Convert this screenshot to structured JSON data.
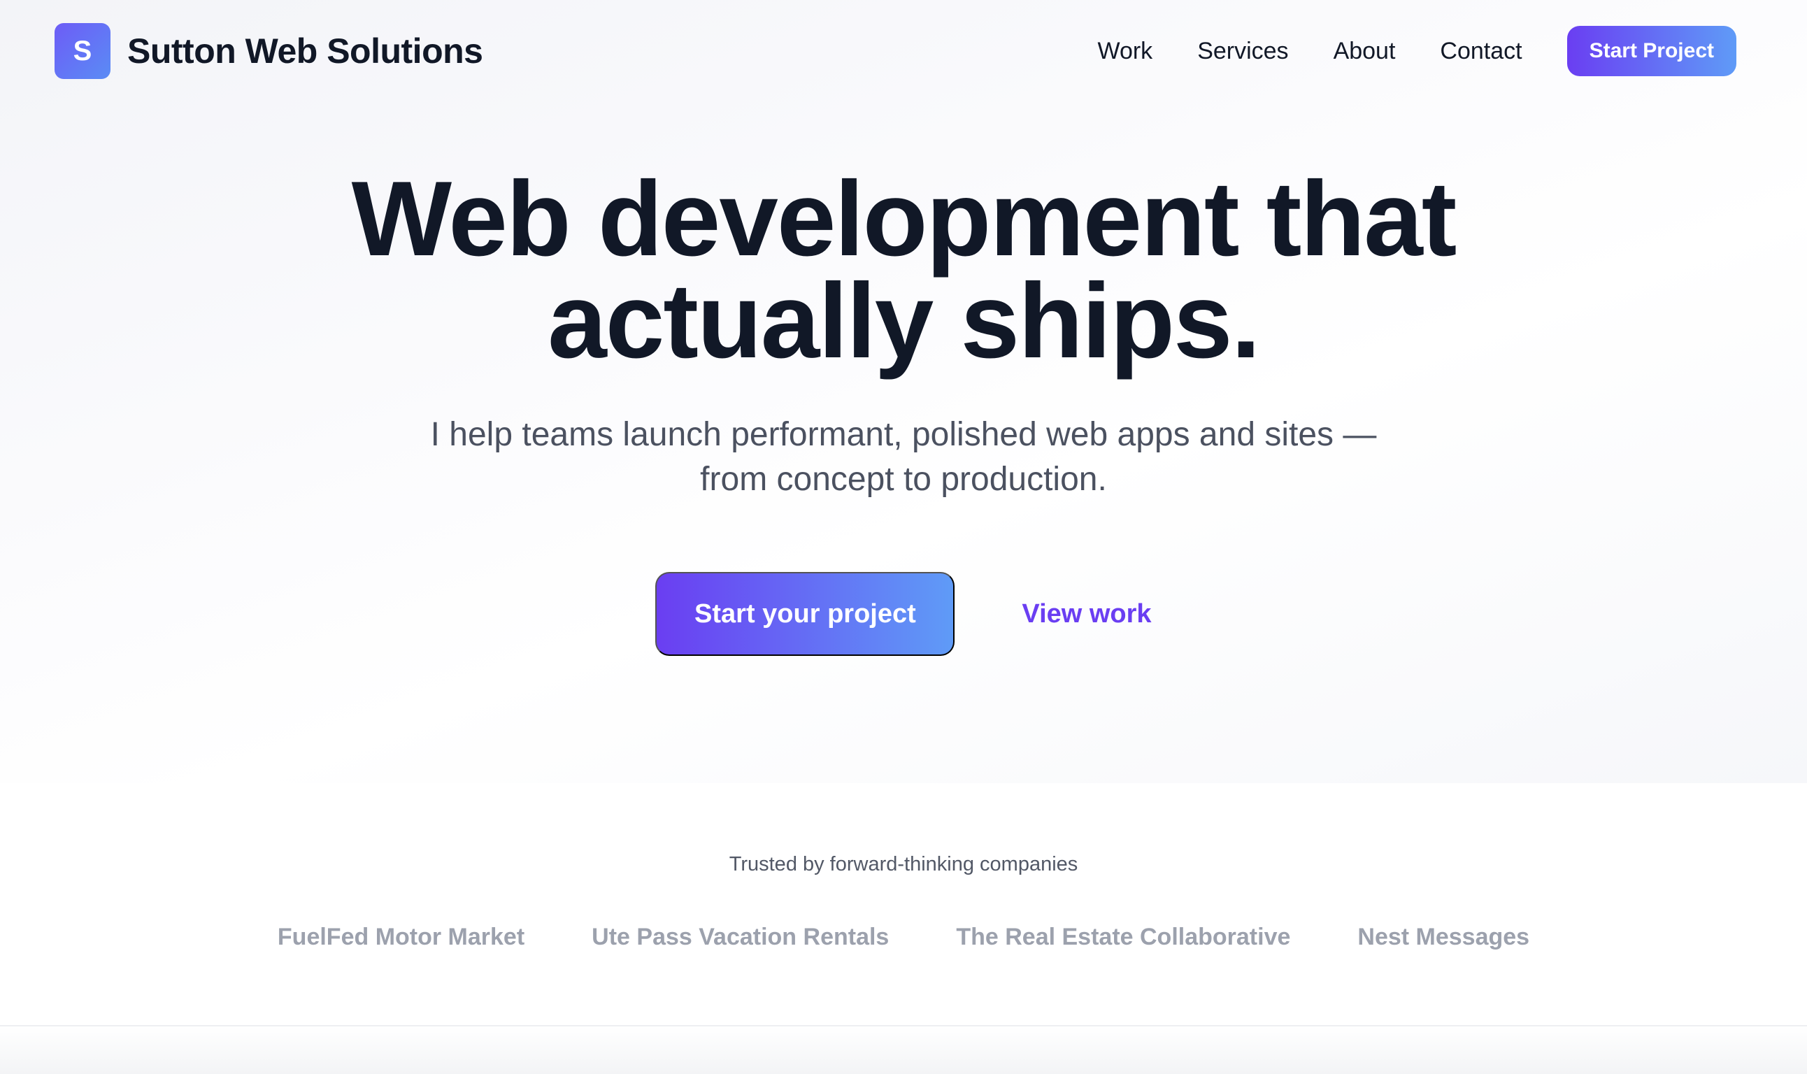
{
  "brand": {
    "logo_letter": "S",
    "name": "Sutton Web Solutions"
  },
  "nav": {
    "items": [
      {
        "label": "Work"
      },
      {
        "label": "Services"
      },
      {
        "label": "About"
      },
      {
        "label": "Contact"
      }
    ],
    "cta_label": "Start Project"
  },
  "hero": {
    "title_line1": "Web development that",
    "title_line2": "actually ships.",
    "subtitle_line1": "I help teams launch performant, polished web apps and sites —",
    "subtitle_line2": "from concept to production.",
    "primary_cta": "Start your project",
    "secondary_cta": "View work"
  },
  "trusted": {
    "label": "Trusted by forward-thinking companies",
    "clients": [
      "FuelFed Motor Market",
      "Ute Pass Vacation Rentals",
      "The Real Estate Collaborative",
      "Nest Messages"
    ]
  },
  "colors": {
    "accent_start": "#6a3ef2",
    "accent_end": "#5f9bf7",
    "text_dark": "#111827",
    "text_muted": "#4b5160",
    "client_gray": "#9ca1ad"
  }
}
